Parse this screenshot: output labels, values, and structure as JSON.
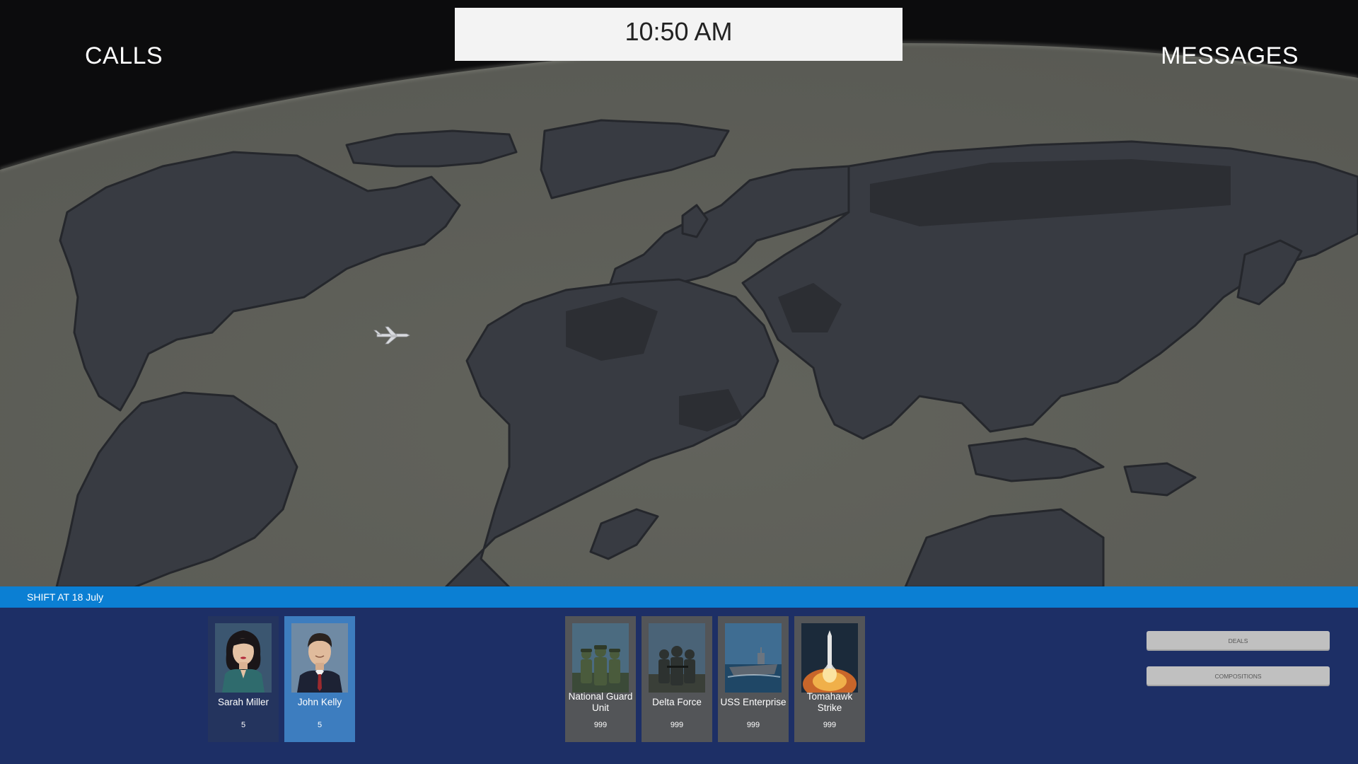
{
  "hud": {
    "calls_label": "CALLS",
    "messages_label": "MESSAGES",
    "clock": "10:50 AM"
  },
  "shift_bar": {
    "text": "SHIFT AT 18 July"
  },
  "agents": [
    {
      "name": "Sarah Miller",
      "count": "5",
      "selected": false
    },
    {
      "name": "John Kelly",
      "count": "5",
      "selected": true
    }
  ],
  "units": [
    {
      "name": "National Guard Unit",
      "count": "999",
      "icon": "soldiers-icon"
    },
    {
      "name": "Delta Force",
      "count": "999",
      "icon": "special-forces-icon"
    },
    {
      "name": "USS Enterprise",
      "count": "999",
      "icon": "aircraft-carrier-icon"
    },
    {
      "name": "Tomahawk Strike",
      "count": "999",
      "icon": "missile-launch-icon"
    }
  ],
  "side_buttons": {
    "deals_label": "DEALS",
    "compositions_label": "COMPOSITIONS"
  },
  "colors": {
    "sky": "#0c0c0d",
    "ocean": "#5d5e58",
    "land": "#383b42",
    "land_dark": "#2c2e33",
    "shift_bar": "#0b7fd3",
    "panel": "#1d2f66",
    "agent_card": "#24345e",
    "agent_card_selected": "#3d7dbf",
    "unit_card": "#535558"
  },
  "icons": {
    "plane": "airplane-icon"
  }
}
